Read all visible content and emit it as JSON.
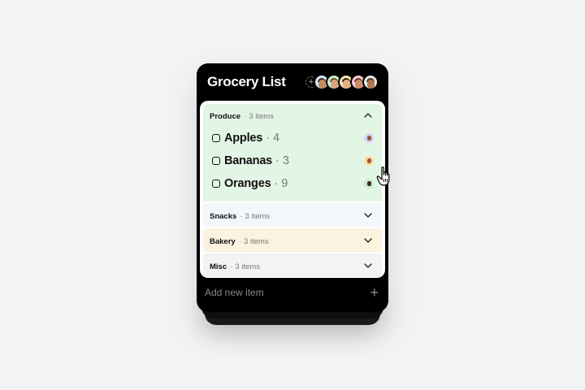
{
  "widget": {
    "title": "Grocery List",
    "collaborators": [
      {
        "name": "collab-1",
        "bg": "#cfe8ff"
      },
      {
        "name": "collab-2",
        "bg": "#c8f0c8"
      },
      {
        "name": "collab-3",
        "bg": "#ffe4a8"
      },
      {
        "name": "collab-4",
        "bg": "#ffc9d8"
      },
      {
        "name": "collab-5",
        "bg": "#e6e6e6"
      }
    ]
  },
  "sections": {
    "produce": {
      "name": "Produce",
      "count": "· 3 items",
      "expanded": true,
      "color": "#e3f6e6",
      "items": [
        {
          "name": "Apples",
          "qty": "· 4",
          "avatar_bg": "#d9d2f3"
        },
        {
          "name": "Bananas",
          "qty": "· 3",
          "avatar_bg": "#ffdca0"
        },
        {
          "name": "Oranges",
          "qty": "· 9",
          "avatar_bg": "#c6eec6"
        }
      ]
    },
    "snacks": {
      "name": "Snacks",
      "count": "· 3 items",
      "color": "#f2f7fb"
    },
    "bakery": {
      "name": "Bakery",
      "count": "· 3 items",
      "color": "#fbf2df"
    },
    "misc": {
      "name": "Misc",
      "count": "· 3 items",
      "color": "#f3f3f3"
    }
  },
  "footer": {
    "placeholder": "Add new item"
  }
}
